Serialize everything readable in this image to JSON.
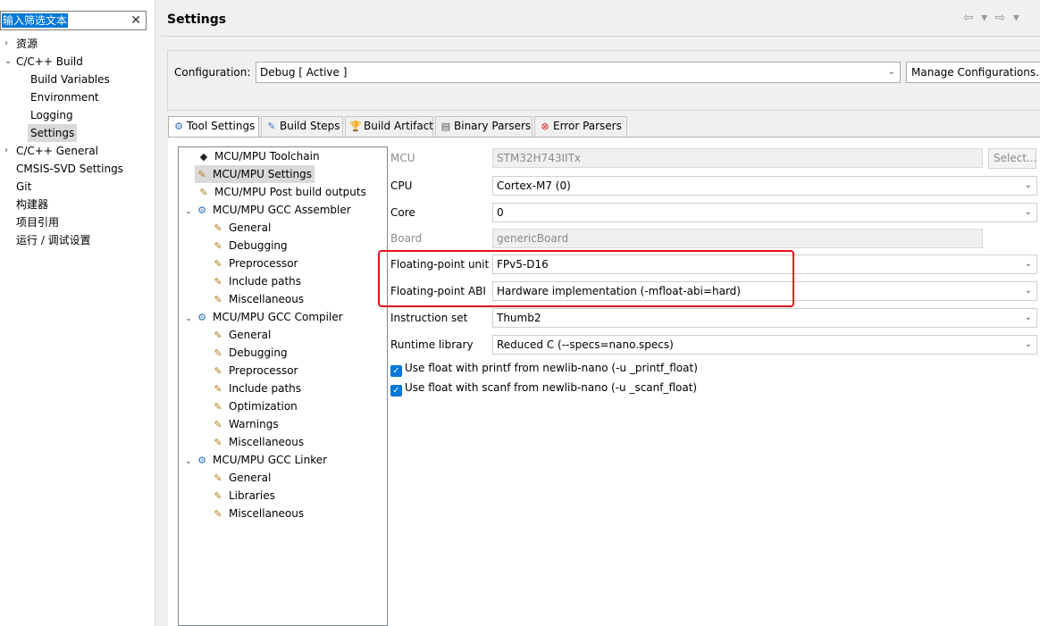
{
  "sidebar": {
    "filter_text": "输入筛选文本",
    "items": [
      {
        "label": "资源",
        "expander": "›"
      },
      {
        "label": "C/C++ Build",
        "expander": "⌄"
      },
      {
        "label": "Build Variables"
      },
      {
        "label": "Environment"
      },
      {
        "label": "Logging"
      },
      {
        "label": "Settings"
      },
      {
        "label": "C/C++ General",
        "expander": "›"
      },
      {
        "label": "CMSIS-SVD Settings"
      },
      {
        "label": "Git"
      },
      {
        "label": "构建器"
      },
      {
        "label": "项目引用"
      },
      {
        "label": "运行 / 调试设置"
      }
    ]
  },
  "header": {
    "title": "Settings",
    "nav": "⇦ ▾ ⇨ ▾"
  },
  "configuration": {
    "label": "Configuration:",
    "value": "Debug  [ Active ]",
    "manage_button": "Manage Configurations..."
  },
  "tabs": [
    {
      "label": "Tool Settings",
      "icon": "tool-settings-icon",
      "glyph": "⚙"
    },
    {
      "label": "Build Steps",
      "icon": "build-steps-icon",
      "glyph": "✎"
    },
    {
      "label": "Build Artifact",
      "icon": "build-artifact-icon",
      "glyph": "🏆"
    },
    {
      "label": "Binary Parsers",
      "icon": "binary-parsers-icon",
      "glyph": "▤"
    },
    {
      "label": "Error Parsers",
      "icon": "error-parsers-icon",
      "glyph": "⊗"
    }
  ],
  "tool_tree": [
    {
      "label": "MCU/MPU Toolchain"
    },
    {
      "label": "MCU/MPU Settings"
    },
    {
      "label": "MCU/MPU Post build outputs"
    },
    {
      "label": "MCU/MPU GCC Assembler"
    },
    {
      "label": "General"
    },
    {
      "label": "Debugging"
    },
    {
      "label": "Preprocessor"
    },
    {
      "label": "Include paths"
    },
    {
      "label": "Miscellaneous"
    },
    {
      "label": "MCU/MPU GCC Compiler"
    },
    {
      "label": "General"
    },
    {
      "label": "Debugging"
    },
    {
      "label": "Preprocessor"
    },
    {
      "label": "Include paths"
    },
    {
      "label": "Optimization"
    },
    {
      "label": "Warnings"
    },
    {
      "label": "Miscellaneous"
    },
    {
      "label": "MCU/MPU GCC Linker"
    },
    {
      "label": "General"
    },
    {
      "label": "Libraries"
    },
    {
      "label": "Miscellaneous"
    }
  ],
  "settings": {
    "mcu": {
      "label": "MCU",
      "value": "STM32H743IITx",
      "select_button": "Select..."
    },
    "cpu": {
      "label": "CPU",
      "value": "Cortex-M7 (0)"
    },
    "core": {
      "label": "Core",
      "value": "0"
    },
    "board": {
      "label": "Board",
      "value": "genericBoard"
    },
    "fpu": {
      "label": "Floating-point unit",
      "value": "FPv5-D16"
    },
    "fpabi": {
      "label": "Floating-point ABI",
      "value": "Hardware implementation (-mfloat-abi=hard)"
    },
    "instruction_set": {
      "label": "Instruction set",
      "value": "Thumb2"
    },
    "runtime_library": {
      "label": "Runtime library",
      "value": "Reduced C (--specs=nano.specs)"
    },
    "printf_float": {
      "label": "Use float with printf from newlib-nano (-u _printf_float)",
      "checked": true
    },
    "scanf_float": {
      "label": "Use float with scanf from newlib-nano (-u _scanf_float)",
      "checked": true
    }
  },
  "colors": {
    "accent": "#0078d7",
    "highlight": "#e0141c"
  }
}
